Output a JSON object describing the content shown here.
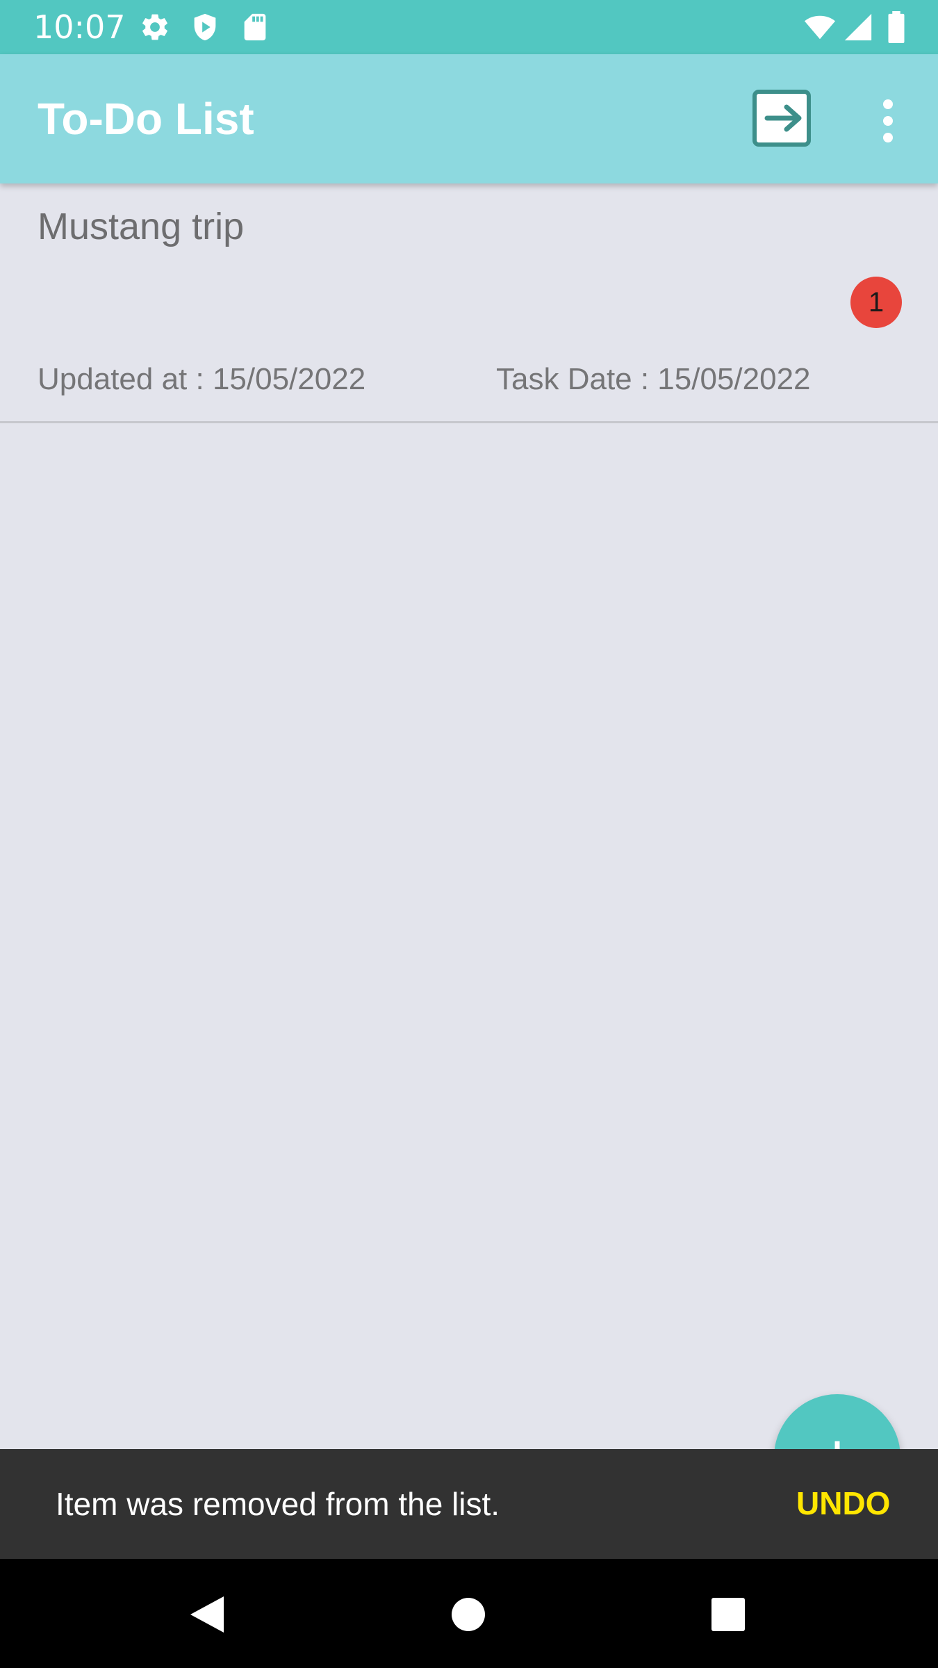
{
  "status_bar": {
    "time": "10:07",
    "icons": [
      "gear-icon",
      "shield-icon",
      "sd-card-icon",
      "wifi-icon",
      "cell-signal-icon",
      "battery-icon"
    ]
  },
  "app_bar": {
    "title": "To-Do List",
    "actions": [
      "exit-icon",
      "more-vert-icon"
    ]
  },
  "tasks": [
    {
      "title": "Mustang trip",
      "badge": "1",
      "updated": "Updated at : 15/05/2022",
      "task_date": "Task Date : 15/05/2022"
    }
  ],
  "fab": {
    "icon": "add-icon",
    "label": "+"
  },
  "snackbar": {
    "message": "Item was removed from the list.",
    "action": "UNDO"
  },
  "colors": {
    "status_bar": "#52c7c1",
    "app_bar": "#8dd9df",
    "background": "#e3e4ec",
    "badge": "#e8453c",
    "snackbar": "#323232",
    "snackbar_action": "#ffe600",
    "fab": "#52c7c1"
  }
}
